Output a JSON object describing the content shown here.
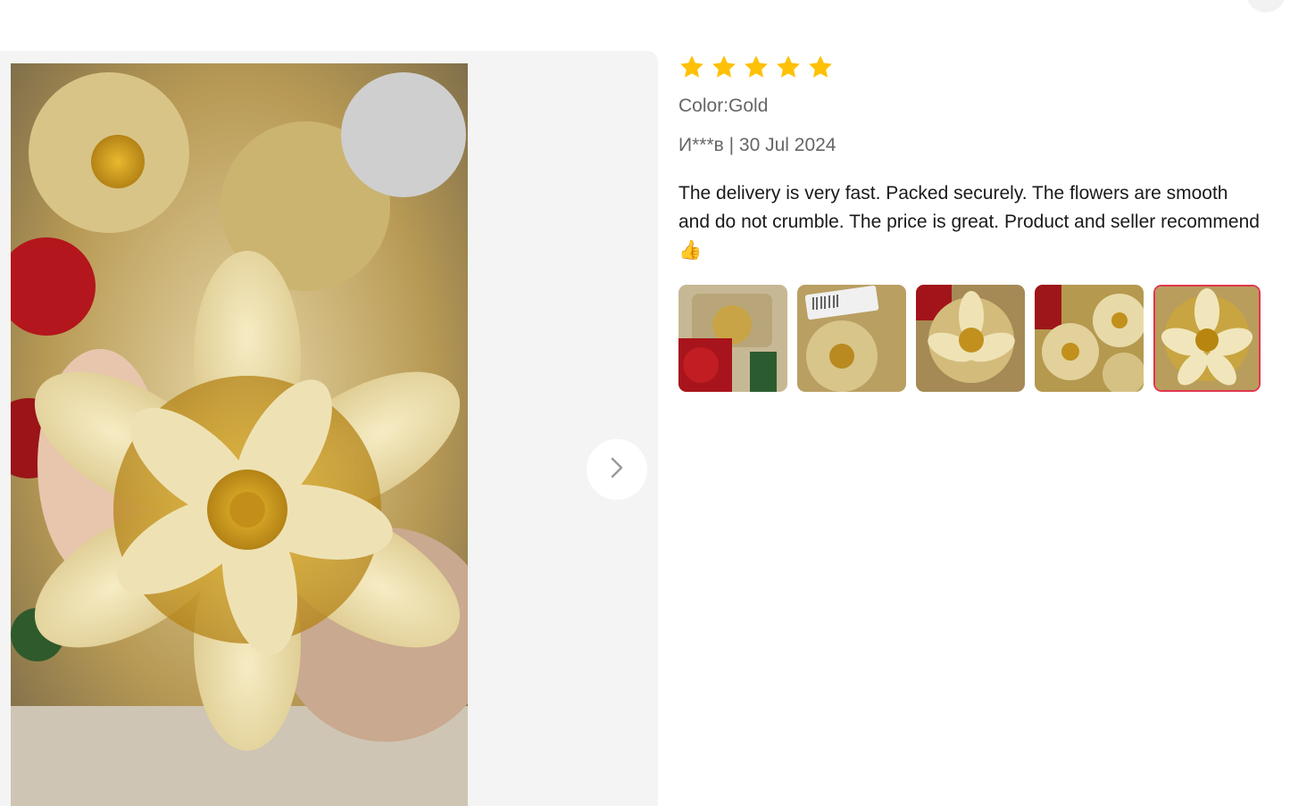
{
  "review": {
    "rating": 5,
    "rating_max": 5,
    "color_label": "Color:Gold",
    "author_date": "И***в | 30 Jul 2024",
    "text": "The delivery is very fast. Packed securely. The flowers are smooth and do not crumble. The price is great. Product and seller recommend👍"
  },
  "gallery": {
    "thumbnail_count": 5,
    "selected_index": 4
  },
  "icons": {
    "star": "star-icon",
    "next": "chevron-right-icon"
  },
  "colors": {
    "star": "#FFC107",
    "selected_border": "#E0374E",
    "gold": "#C9A23A"
  }
}
